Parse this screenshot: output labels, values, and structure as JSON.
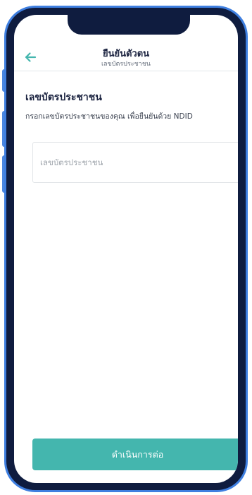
{
  "header": {
    "title": "ยืนยันตัวตน",
    "subtitle": "เลขบัตรประชาชน",
    "back_icon": "arrow-left-icon"
  },
  "form": {
    "section_title": "เลขบัตรประชาชน",
    "description": "กรอกเลขบัตรประชาชนของคุณ เพื่อยืนยันด้วย NDID",
    "id_input_placeholder": "เลขบัตรประชาชน",
    "id_input_value": ""
  },
  "footer": {
    "continue_label": "ดำเนินการต่อ"
  },
  "colors": {
    "accent": "#44b6ae",
    "frame": "#3f7fe0",
    "bezel": "#0f1c3f",
    "title_text": "#1b2340"
  }
}
